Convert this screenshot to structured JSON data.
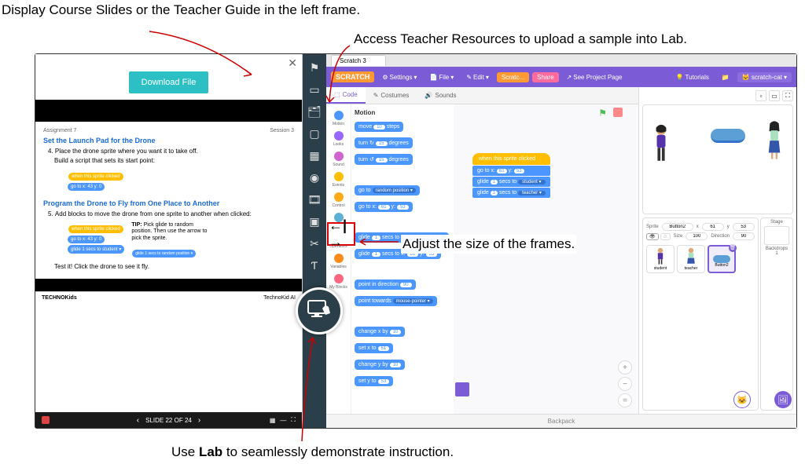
{
  "annotations": {
    "top_left": "Display Course Slides or the Teacher Guide in the left frame.",
    "top_right": "Access Teacher Resources to upload a sample into Lab.",
    "middle": "Adjust the size of the frames.",
    "bottom_pre": "Use ",
    "bottom_bold": "Lab",
    "bottom_post": " to seamlessly demonstrate instruction."
  },
  "left_pane": {
    "download": "Download File",
    "assignment_label": "Assignment 7",
    "session_label": "Session 3",
    "h1": "Set the Launch Pad for the Drone",
    "step4_num": "4.",
    "step4": "Place the drone sprite where you want it to take off.",
    "step4b": "Build a script that sets its start point:",
    "block_event": "when this sprite clicked",
    "block_goto": "go to x: 43  y: 0",
    "h2": "Program the Drone to Fly from One Place to Another",
    "step5_num": "5.",
    "step5": "Add blocks to move the drone from one sprite to another when clicked:",
    "tip_bold": "TIP:",
    "tip": " Pick glide to random position. Then use the arrow to pick the sprite.",
    "block_glide1": "glide 1 secs to student ▾",
    "block_glide2": "glide 1 secs to random position ▾",
    "test": "Test it! Click the drone to see it fly.",
    "footer_left": "TECHNOKids",
    "footer_right": "TechnoKid AI",
    "nav": "SLIDE 22 OF 24"
  },
  "rail": [
    "flag",
    "book",
    "resources",
    "board",
    "calc",
    "video",
    "film",
    "media",
    "snip",
    "text"
  ],
  "resize_glyph": "⇤⇥",
  "scratch": {
    "tab": "Scratch 3",
    "logo": "SCRATCH",
    "settings": "Settings",
    "file": "File",
    "edit": "Edit",
    "scratcher": "Scratc...",
    "share": "Share",
    "see_project": "See Project Page",
    "tutorials": "Tutorials",
    "user": "scratch-cat",
    "tabs": {
      "code": "Code",
      "costumes": "Costumes",
      "sounds": "Sounds"
    },
    "categories": [
      {
        "cls": "cat-motion",
        "label": "Motion"
      },
      {
        "cls": "cat-looks",
        "label": "Looks"
      },
      {
        "cls": "cat-sound",
        "label": "Sound"
      },
      {
        "cls": "cat-events",
        "label": "Events"
      },
      {
        "cls": "cat-control",
        "label": "Control"
      },
      {
        "cls": "cat-sensing",
        "label": "Sensing"
      },
      {
        "cls": "cat-ops",
        "label": "Operators"
      },
      {
        "cls": "cat-vars",
        "label": "Variables"
      },
      {
        "cls": "cat-my",
        "label": "My Blocks"
      }
    ],
    "palette_header": "Motion",
    "palette": [
      "move <10> steps",
      "turn ↻ <15> degrees",
      "turn ↺ <15> degrees",
      "go to [random position ▾]",
      "go to x: <61> y: <53>",
      "glide <1> secs to [random position ▾]",
      "glide <1> secs to x: <61> y: <53>",
      "point in direction <90>",
      "point towards [mouse-pointer ▾]",
      "change x by <10>",
      "set x to <61>",
      "change y by <10>",
      "set y to <53>"
    ],
    "script_stack": {
      "event": "when this sprite clicked",
      "blocks": [
        "go to x: (61) y: (53)",
        "glide (1) secs to [student ▾]",
        "glide (1) secs to [teacher ▾]"
      ]
    },
    "sprite_info": {
      "name_lbl": "Sprite",
      "name": "Button2",
      "x_lbl": "x",
      "x": "61",
      "y_lbl": "y",
      "y": "53",
      "size_lbl": "Size",
      "size": "100",
      "dir_lbl": "Direction",
      "dir": "90"
    },
    "sprites": [
      "student",
      "teacher",
      "Button2"
    ],
    "stage_label": "Stage",
    "backdrops_label": "Backdrops",
    "backdrops_count": "1",
    "backpack": "Backpack"
  }
}
